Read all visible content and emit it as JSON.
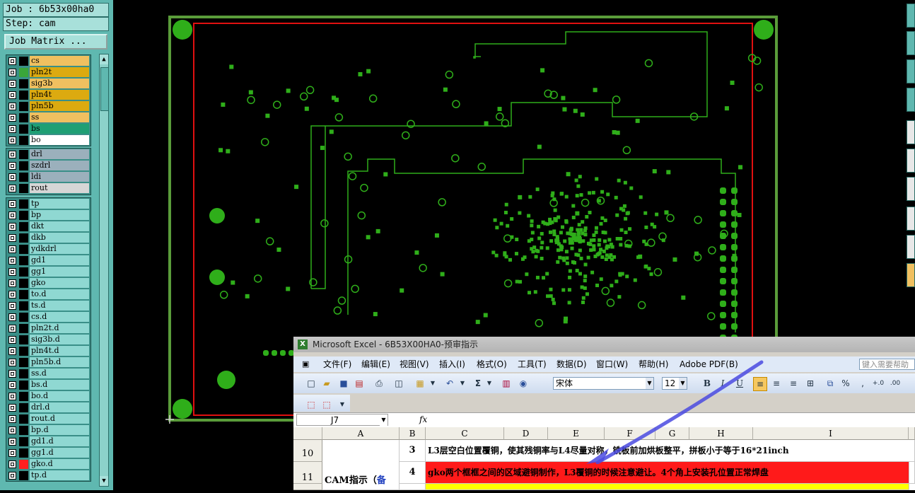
{
  "job": {
    "job_line": "Job : 6b53x00ha0",
    "step_line": "Step: cam",
    "matrix_button": "Job Matrix ..."
  },
  "layers_group1": [
    {
      "name": "cs",
      "color": "#f0c060",
      "mark": "#000000"
    },
    {
      "name": "pln2t",
      "color": "#dcaa10",
      "mark": "#3aa63a"
    },
    {
      "name": "sig3b",
      "color": "#f0c060",
      "mark": "#000000"
    },
    {
      "name": "pln4t",
      "color": "#dcaa10",
      "mark": "#000000"
    },
    {
      "name": "pln5b",
      "color": "#dcaa10",
      "mark": "#000000"
    },
    {
      "name": "ss",
      "color": "#f0c060",
      "mark": "#000000"
    },
    {
      "name": "bs",
      "color": "#1f9f74",
      "mark": "#000000"
    },
    {
      "name": "bo",
      "color": "#ffffff",
      "mark": "#000000"
    }
  ],
  "layers_group2": [
    {
      "name": "drl",
      "color": "#9bb0bc",
      "mark": "#000000"
    },
    {
      "name": "szdrl",
      "color": "#9bb0bc",
      "mark": "#000000"
    },
    {
      "name": "ldi",
      "color": "#9bb0bc",
      "mark": "#000000"
    },
    {
      "name": "rout",
      "color": "#d6d6d6",
      "mark": "#000000"
    }
  ],
  "layers_group3": [
    {
      "name": "tp",
      "color": "#8fd8d2",
      "mark": "#000000"
    },
    {
      "name": "bp",
      "color": "#8fd8d2",
      "mark": "#000000"
    },
    {
      "name": "dkt",
      "color": "#8fd8d2",
      "mark": "#000000"
    },
    {
      "name": "dkb",
      "color": "#8fd8d2",
      "mark": "#000000"
    },
    {
      "name": "ydkdrl",
      "color": "#8fd8d2",
      "mark": "#000000"
    },
    {
      "name": "gd1",
      "color": "#8fd8d2",
      "mark": "#000000"
    },
    {
      "name": "gg1",
      "color": "#8fd8d2",
      "mark": "#000000"
    },
    {
      "name": "gko",
      "color": "#8fd8d2",
      "mark": "#000000"
    },
    {
      "name": "to.d",
      "color": "#8fd8d2",
      "mark": "#000000"
    },
    {
      "name": "ts.d",
      "color": "#8fd8d2",
      "mark": "#000000"
    },
    {
      "name": "cs.d",
      "color": "#8fd8d2",
      "mark": "#000000"
    },
    {
      "name": "pln2t.d",
      "color": "#8fd8d2",
      "mark": "#000000"
    },
    {
      "name": "sig3b.d",
      "color": "#8fd8d2",
      "mark": "#000000"
    },
    {
      "name": "pln4t.d",
      "color": "#8fd8d2",
      "mark": "#000000"
    },
    {
      "name": "pln5b.d",
      "color": "#8fd8d2",
      "mark": "#000000"
    },
    {
      "name": "ss.d",
      "color": "#8fd8d2",
      "mark": "#000000"
    },
    {
      "name": "bs.d",
      "color": "#8fd8d2",
      "mark": "#000000"
    },
    {
      "name": "bo.d",
      "color": "#8fd8d2",
      "mark": "#000000"
    },
    {
      "name": "drl.d",
      "color": "#8fd8d2",
      "mark": "#000000"
    },
    {
      "name": "rout.d",
      "color": "#8fd8d2",
      "mark": "#000000"
    },
    {
      "name": "bp.d",
      "color": "#8fd8d2",
      "mark": "#000000"
    },
    {
      "name": "gd1.d",
      "color": "#8fd8d2",
      "mark": "#000000"
    },
    {
      "name": "gg1.d",
      "color": "#8fd8d2",
      "mark": "#000000"
    },
    {
      "name": "gko.d",
      "color": "#8fd8d2",
      "mark": "#ff2020"
    },
    {
      "name": "tp.d",
      "color": "#8fd8d2",
      "mark": "#000000"
    }
  ],
  "board_colors": {
    "outline": "#5a9c3a",
    "profile": "#e01010",
    "features": "#2fae1a"
  },
  "excel": {
    "title": "Microsoft Excel - 6B53X00HA0-预审指示",
    "title_icon": "X",
    "menu": [
      "文件(F)",
      "编辑(E)",
      "视图(V)",
      "插入(I)",
      "格式(O)",
      "工具(T)",
      "数据(D)",
      "窗口(W)",
      "帮助(H)",
      "Adobe PDF(B)"
    ],
    "help_placeholder": "键入需要帮助",
    "font_name": "宋体",
    "font_size": "12",
    "name_box": "J7",
    "fx": "fx",
    "columns": [
      "A",
      "B",
      "C",
      "D",
      "E",
      "F",
      "G",
      "H",
      "I"
    ],
    "rows": [
      {
        "num": "10",
        "b": "3",
        "c": "L3层空白位置覆铜，使其残铜率与L4尽量对称，铣板前加烘板整平，拼板小于等于16*21inch",
        "bg": "#ffffff",
        "fg": "#000000"
      },
      {
        "num": "11",
        "b": "4",
        "c": "gko两个框框之间的区域避铜制作，L3覆铜的时候注意避让。4个角上安装孔位置正常焊盘",
        "bg": "#ff1a1a",
        "fg": "#000000"
      }
    ],
    "merged_a_prefix": "CAM指示（",
    "merged_a_suffix": "备"
  }
}
